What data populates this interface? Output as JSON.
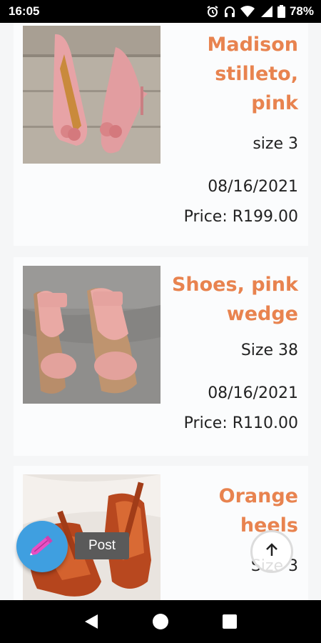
{
  "status_bar": {
    "time": "16:05",
    "battery": "78%",
    "icons": [
      "alarm-icon",
      "headphones-icon",
      "wifi-icon",
      "signal-icon",
      "battery-icon"
    ]
  },
  "listings": [
    {
      "title": "Madison stilleto, pink",
      "size": "size 3",
      "date": "08/16/2021",
      "price": "Price: R199.00",
      "image": "pink-stiletto-photo"
    },
    {
      "title": "Shoes, pink wedge",
      "size": "Size 38",
      "date": "08/16/2021",
      "price": "Price: R110.00",
      "image": "pink-wedge-photo"
    },
    {
      "title": "Orange heels",
      "size": "Size 3",
      "image": "orange-heels-photo"
    }
  ],
  "fab": {
    "icon": "pencil-icon",
    "tooltip": "Post"
  },
  "scroll_top": {
    "icon": "arrow-up-icon"
  },
  "nav": {
    "icons": [
      "back-icon",
      "home-icon",
      "recents-icon"
    ]
  },
  "colors": {
    "title": "#e8834f",
    "fab": "#3f9fe0",
    "tooltip": "#5a5a5a"
  }
}
